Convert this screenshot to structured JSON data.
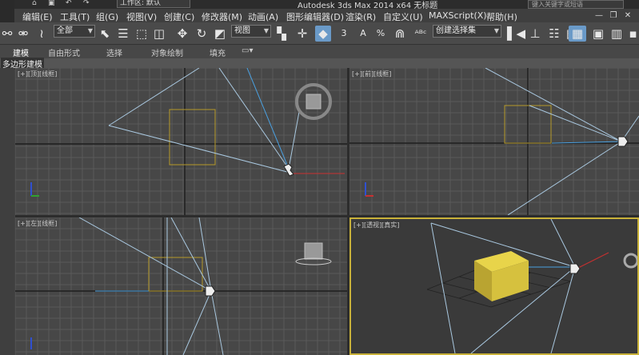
{
  "title_bar": {
    "workspace_label": "工作区: 默认",
    "app_title": "Autodesk 3ds Max  2014 x64     无标题",
    "search_placeholder": "键入关键字或短语"
  },
  "menu": {
    "items": [
      "编辑(E)",
      "工具(T)",
      "组(G)",
      "视图(V)",
      "创建(C)",
      "修改器(M)",
      "动画(A)",
      "图形编辑器(D)",
      "渲染(R)",
      "自定义(U)",
      "MAXScript(X)",
      "帮助(H)"
    ]
  },
  "toolbar": {
    "selection_filter": "全部",
    "reference_coord": "视图",
    "named_selection_placeholder": "创建选择集",
    "snap_label": "3",
    "angle_snap_label": "A",
    "percent_snap_label": "%"
  },
  "ribbon": {
    "tabs": [
      "建模",
      "自由形式",
      "选择",
      "对象绘制",
      "填充"
    ],
    "active_tab": "建模",
    "subtab": "多边形建模"
  },
  "viewports": {
    "top": {
      "label": "[+][顶][线框]"
    },
    "front": {
      "label": "[+][前][线框]"
    },
    "left": {
      "label": "[+][左][线框]"
    },
    "perspective": {
      "label": "[+][透视][真实]"
    }
  },
  "colors": {
    "grid_line": "#5a5a5a",
    "grid_axis": "#1e1e1e",
    "light_cone": "#a9c8e0",
    "box_wire": "#b69a2a",
    "box_solid": "#d8c23a",
    "active_border": "#c9b23a",
    "axis_x": "#c83030",
    "axis_y": "#30a030",
    "axis_z": "#3050d0"
  }
}
